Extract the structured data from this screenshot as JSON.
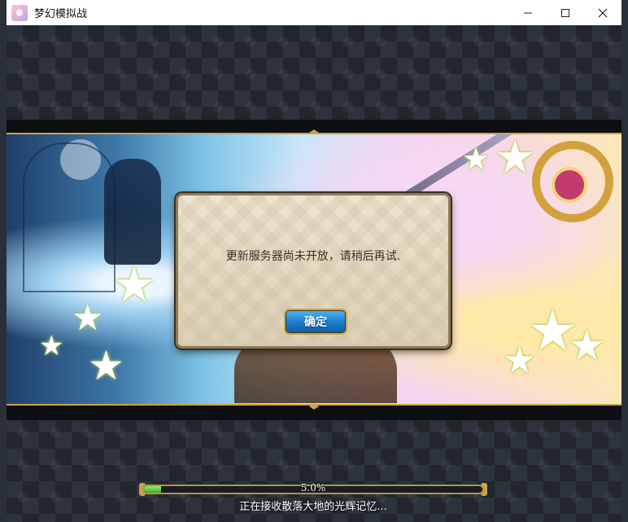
{
  "window": {
    "title": "梦幻模拟战",
    "minimize_icon": "minimize-icon",
    "maximize_icon": "maximize-icon",
    "close_icon": "close-icon"
  },
  "dialog": {
    "message": "更新服务器尚未开放，请稍后再试.",
    "ok_label": "确定"
  },
  "loading": {
    "progress_text": "5.0%",
    "progress_fraction": 0.05,
    "status": "正在接收散落大地的光辉记忆..."
  },
  "colors": {
    "frame_gold": "#c9a44c",
    "button_blue": "#1d7fcf",
    "progress_green": "#3fa82b"
  }
}
